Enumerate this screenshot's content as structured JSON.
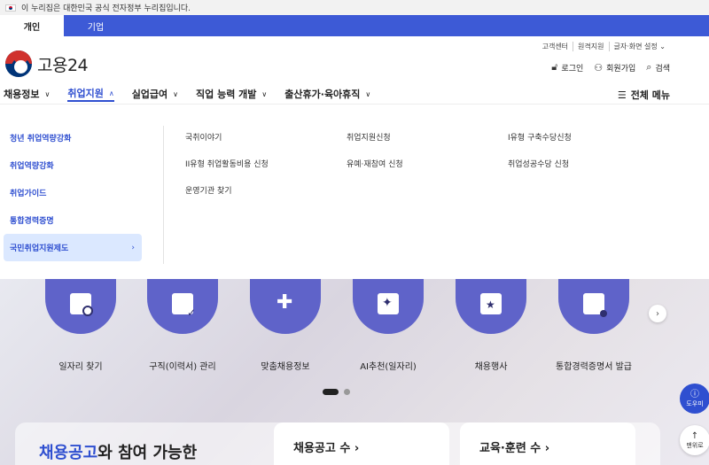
{
  "gov_banner": {
    "text": "이 누리집은 대한민국 공식 전자정부 누리집입니다."
  },
  "audience_tabs": [
    {
      "label": "개인"
    },
    {
      "label": "기업"
    }
  ],
  "util_links": [
    "고객센터",
    "원격지원",
    "글자·화면 설정"
  ],
  "logo": {
    "text": "고용24"
  },
  "user_actions": {
    "login": "로그인",
    "signup": "회원가입",
    "search": "검색"
  },
  "gnb": [
    "채용정보",
    "취업지원",
    "실업급여",
    "직업 능력 개발",
    "출산휴가·육아휴직"
  ],
  "full_menu": "전체 메뉴",
  "mega_menu": {
    "sub_nav": [
      "청년 취업역량강화",
      "취업역량강화",
      "취업가이드",
      "통합경력증명",
      "국민취업지원제도"
    ],
    "links": [
      "국취이야기",
      "취업지원신청",
      "I유형 구축수당신청",
      "II유형 취업활동비용 신청",
      "유예·재참여 신청",
      "취업성공수당 신청",
      "운영기관 찾기"
    ]
  },
  "quick_menu": [
    "일자리 찾기",
    "구직(이력서) 관리",
    "맞춤채용정보",
    "AI추천(일자리)",
    "채용행사",
    "통합경력증명서 발급"
  ],
  "section_title": {
    "highlight": "채용공고",
    "rest": "와 참여 가능한"
  },
  "stat_cards": [
    "채용공고 수 ›",
    "교육·훈련 수 ›"
  ],
  "floating": {
    "help": "도우미",
    "top": "맨위로"
  }
}
